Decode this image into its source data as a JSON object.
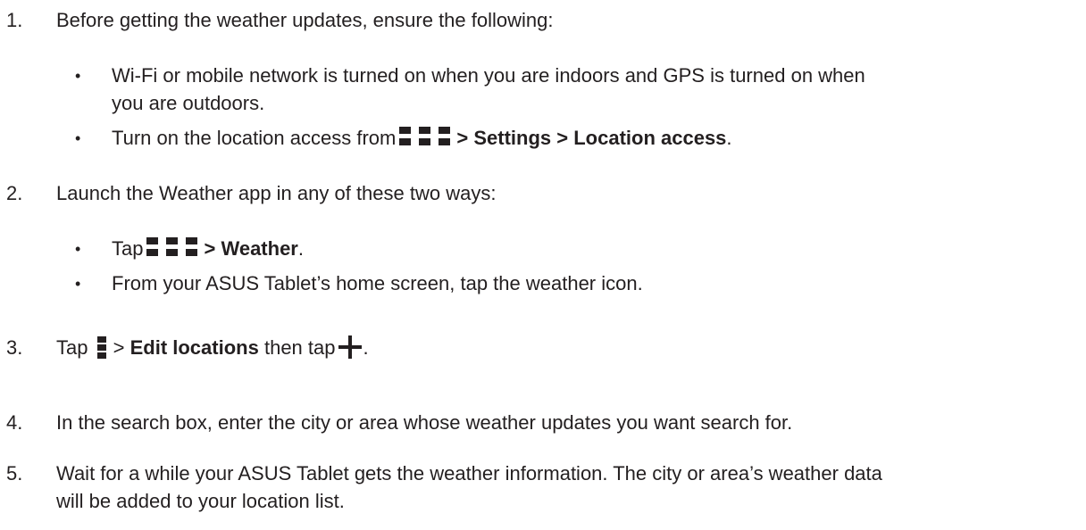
{
  "steps": [
    {
      "number": "1.",
      "text": "Before getting the weather updates, ensure the following:",
      "bullets": [
        {
          "dot": "•",
          "line1": "Wi-Fi or mobile network is turned on when you are indoors and GPS is turned on when",
          "line2": "you are outdoors."
        },
        {
          "dot": "•",
          "prefix": "Turn on the location access from",
          "sep1": ">",
          "settings": "Settings",
          "sep2": ">",
          "location_access": "Location access",
          "suffix": "."
        }
      ]
    },
    {
      "number": "2.",
      "text": "Launch the Weather app in any of these two ways:",
      "bullets": [
        {
          "dot": "•",
          "prefix": "Tap",
          "sep": ">",
          "weather": "Weather",
          "suffix": "."
        },
        {
          "dot": "•",
          "text": "From your ASUS Tablet’s home screen, tap the weather icon."
        }
      ]
    },
    {
      "number": "3.",
      "prefix": "Tap",
      "sep": ">",
      "edit_locations": "Edit locations",
      "middle": "then tap",
      "suffix": "."
    },
    {
      "number": "4.",
      "text": "In the search box, enter the city or area whose weather updates you want search for."
    },
    {
      "number": "5.",
      "line1": "Wait for a while your ASUS Tablet gets the weather information. The city or area’s weather data",
      "line2": "will be added to your location list."
    }
  ],
  "icons": {
    "apps": "all-apps-grid-icon",
    "menu": "menu-icon",
    "add": "plus-icon"
  }
}
